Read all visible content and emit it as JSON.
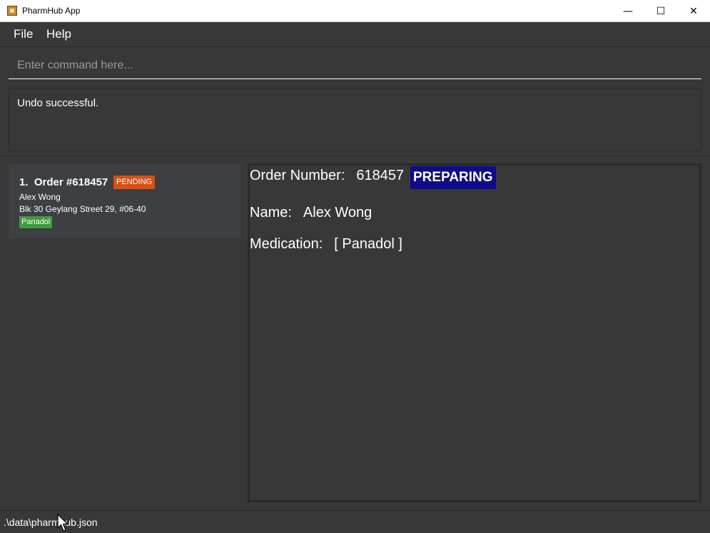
{
  "window": {
    "title": "PharmHub App",
    "minimize_glyph": "—",
    "maximize_glyph": "☐",
    "close_glyph": "✕"
  },
  "menu": {
    "file": "File",
    "help": "Help"
  },
  "command": {
    "placeholder": "Enter command here...",
    "value": ""
  },
  "result": {
    "message": "Undo successful."
  },
  "orders": [
    {
      "index": "1.",
      "title": "Order #618457",
      "status": "PENDING",
      "name": "Alex Wong",
      "address": "Blk 30 Geylang Street 29, #06-40",
      "medications": [
        "Panadol"
      ]
    }
  ],
  "detail": {
    "order_number_label": "Order Number:",
    "order_number": "618457",
    "status": "PREPARING",
    "name_label": "Name:",
    "name": "Alex Wong",
    "medication_label": "Medication:",
    "medication": "[ Panadol ]"
  },
  "status_bar": {
    "path": ".\\data\\pharmhub.json"
  },
  "colors": {
    "background": "#383838",
    "pending": "#d94f14",
    "preparing": "#0c0c8c",
    "medication_tag": "#3e9b3e"
  }
}
